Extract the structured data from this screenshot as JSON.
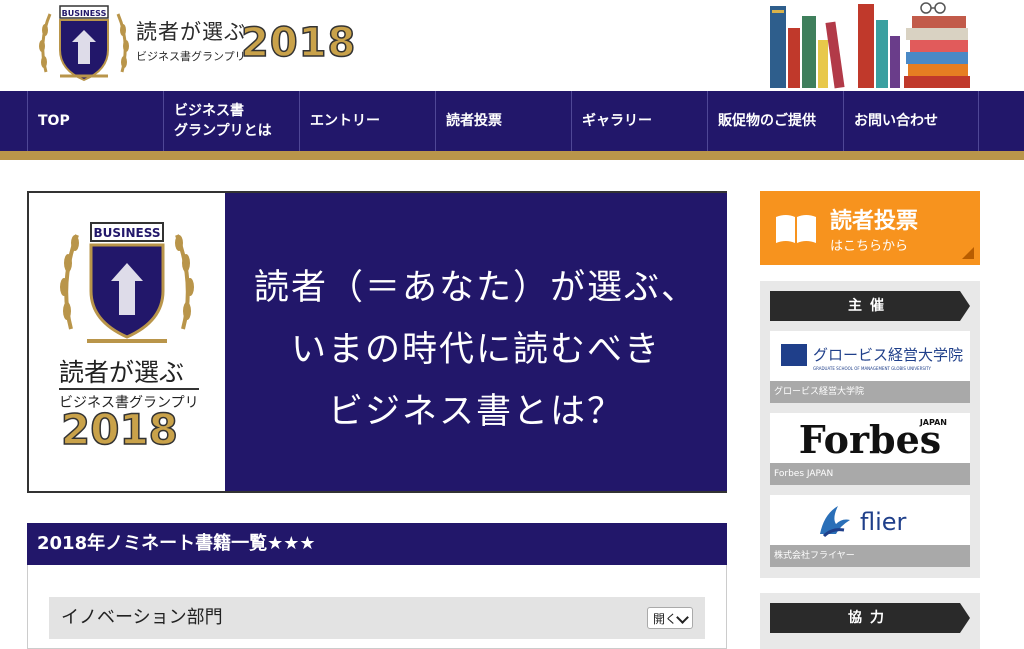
{
  "header": {
    "logo_title": "読者が選ぶ",
    "logo_subtitle": "ビジネス書グランプリ",
    "logo_year": "2018",
    "crest_text": "BUSINESS"
  },
  "nav": {
    "items": [
      {
        "label": "TOP"
      },
      {
        "label": "ビジネス書\nグランプリとは"
      },
      {
        "label": "エントリー"
      },
      {
        "label": "読者投票"
      },
      {
        "label": "ギャラリー"
      },
      {
        "label": "販促物のご提供"
      },
      {
        "label": "お問い合わせ"
      }
    ]
  },
  "hero": {
    "lines": [
      "読者（＝あなた）が選ぶ、",
      "いまの時代に読むべき",
      "ビジネス書とは？"
    ],
    "logo_title": "読者が選ぶ",
    "logo_subtitle": "ビジネス書グランプリ",
    "logo_year": "2018",
    "crest_text": "BUSINESS"
  },
  "nominees": {
    "heading": "2018年ノミネート書籍一覧★★★",
    "categories": [
      {
        "label": "イノベーション部門",
        "toggle": "開く"
      }
    ]
  },
  "sidebar": {
    "vote": {
      "title": "読者投票",
      "subtitle": "はこちらから"
    },
    "organizer": {
      "heading": "主催",
      "sponsors": [
        {
          "logo_text": "グロービス経営大学院",
          "logo_small": "GRADUATE SCHOOL OF MANAGEMENT GLOBIS UNIVERSITY",
          "caption": "グロービス経営大学院"
        },
        {
          "logo_text": "Forbes",
          "logo_small": "JAPAN",
          "caption": "Forbes JAPAN"
        },
        {
          "logo_text": "flier",
          "caption": "株式会社フライヤー"
        }
      ]
    },
    "cooperation": {
      "heading": "協力"
    }
  },
  "colors": {
    "navy": "#22176a",
    "gold": "#b9954a",
    "orange": "#f7931e"
  }
}
